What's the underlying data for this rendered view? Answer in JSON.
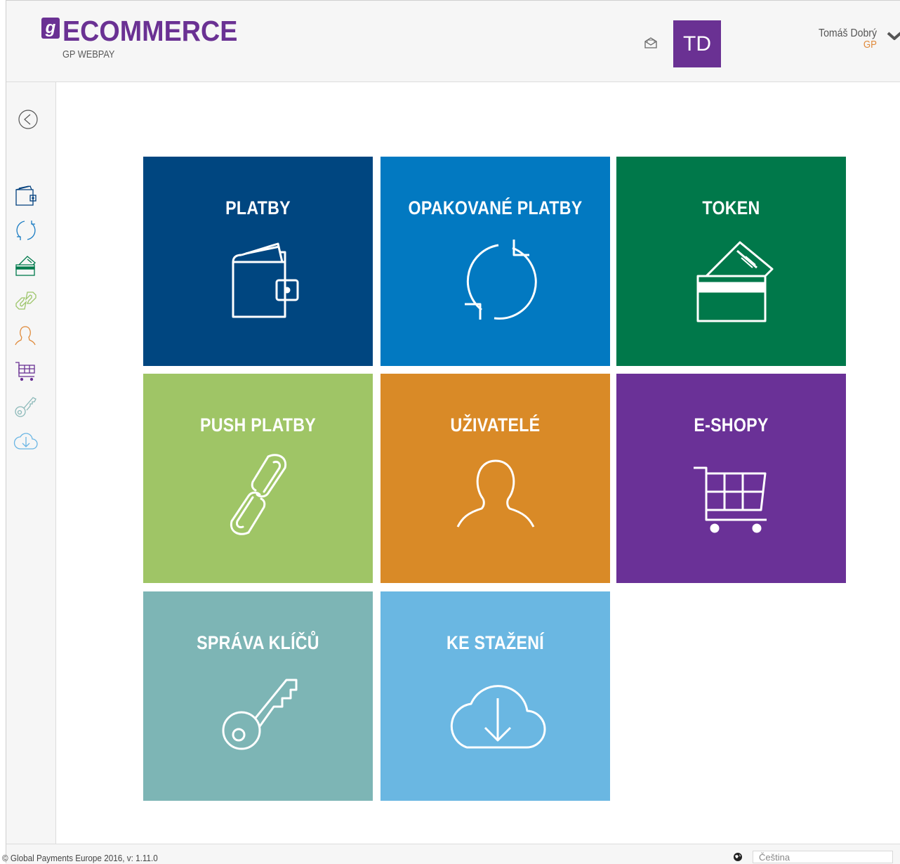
{
  "header": {
    "logo_mark": "g",
    "logo_text": "ECOMMERCE",
    "logo_sub": "GP WEBPAY",
    "avatar_initials": "TD",
    "user_name": "Tomáš Dobrý",
    "user_org": "GP",
    "icons": {
      "mail": "mail-icon",
      "chevron": "chevron-down-icon"
    }
  },
  "sidebar": {
    "items": [
      {
        "name": "wallet-icon",
        "color": "#003f7d"
      },
      {
        "name": "refresh-icon",
        "color": "#1a7cc3"
      },
      {
        "name": "card-icon",
        "color": "#007a4c"
      },
      {
        "name": "link-icon",
        "color": "#9dc56a"
      },
      {
        "name": "user-icon",
        "color": "#e08a3a"
      },
      {
        "name": "cart-icon",
        "color": "#6a3193"
      },
      {
        "name": "key-icon",
        "color": "#8ab8b8"
      },
      {
        "name": "cloud-download-icon",
        "color": "#6bb6e4"
      }
    ]
  },
  "tiles": [
    {
      "title": "PLATBY",
      "color": "#004680",
      "icon": "wallet-icon"
    },
    {
      "title": "OPAKOVANÉ PLATBY",
      "color": "#0279c1",
      "icon": "refresh-icon"
    },
    {
      "title": "TOKEN",
      "color": "#00784a",
      "icon": "card-icon"
    },
    {
      "title": "PUSH PLATBY",
      "color": "#9fc566",
      "icon": "link-icon"
    },
    {
      "title": "UŽIVATELÉ",
      "color": "#d98a27",
      "icon": "user-icon"
    },
    {
      "title": "E-SHOPY",
      "color": "#6a3197",
      "icon": "cart-icon"
    },
    {
      "title": "SPRÁVA KLÍČŮ",
      "color": "#7db5b5",
      "icon": "key-icon"
    },
    {
      "title": "KE STAŽENÍ",
      "color": "#6ab7e2",
      "icon": "cloud-download-icon"
    }
  ],
  "footer": {
    "copyright": "© Global Payments Europe 2016, v: 1.11.0",
    "language": "Čeština"
  }
}
